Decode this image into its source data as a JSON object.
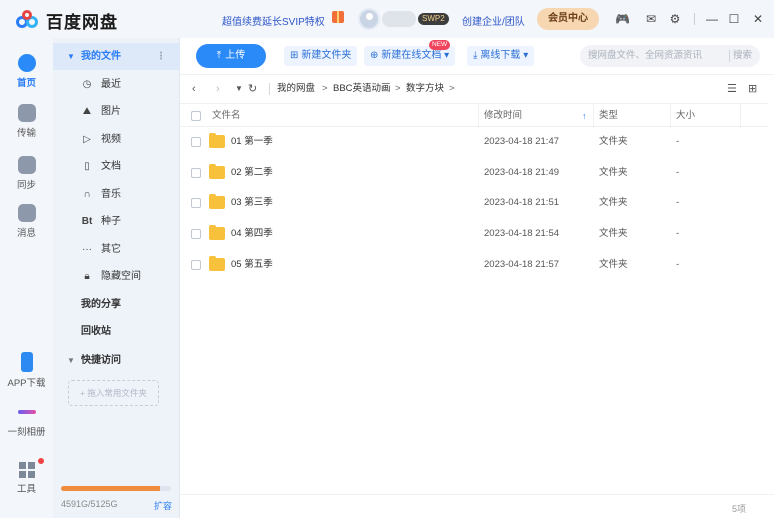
{
  "app": {
    "title": "百度网盘",
    "promo": "超值续费延长SVIP特权",
    "badge": "SWP2",
    "enterprise": "创建企业/团队",
    "member_center": "会员中心"
  },
  "window_icons": [
    "game-icon",
    "mail-icon",
    "settings-icon",
    "minimize-icon",
    "maximize-icon",
    "close-icon"
  ],
  "rail": {
    "home": "首页",
    "transfer": "传输",
    "sync": "同步",
    "messages": "消息",
    "app_download": "APP下载",
    "photo": "一刻相册",
    "tools": "工具"
  },
  "nav": {
    "my_files": "我的文件",
    "recent": "最近",
    "images": "图片",
    "videos": "视频",
    "docs": "文档",
    "music": "音乐",
    "torrents": "种子",
    "others": "其它",
    "hidden": "隐藏空间",
    "my_share": "我的分享",
    "recycle": "回收站",
    "quick_access": "快捷访问",
    "drag_hint": "+ 拖入常用文件夹",
    "storage_text": "4591G/5125G",
    "storage_used_fraction": 0.896,
    "expand": "扩容"
  },
  "toolbar": {
    "upload": "上传",
    "new_folder": "新建文件夹",
    "new_doc": "新建在线文档",
    "new_badge": "NEW",
    "offline_download": "离线下载",
    "search_placeholder": "搜网盘文件、全网资源资讯",
    "search_button": "搜索"
  },
  "breadcrumb": [
    "我的网盘",
    "BBC英语动画",
    "数字方块"
  ],
  "table": {
    "col_name": "文件名",
    "col_time": "修改时间",
    "col_type": "类型",
    "col_size": "大小",
    "rows": [
      {
        "name": "01 第一季",
        "time": "2023-04-18 21:47",
        "type": "文件夹",
        "size": "-"
      },
      {
        "name": "02 第二季",
        "time": "2023-04-18 21:49",
        "type": "文件夹",
        "size": "-"
      },
      {
        "name": "03 第三季",
        "time": "2023-04-18 21:51",
        "type": "文件夹",
        "size": "-"
      },
      {
        "name": "04 第四季",
        "time": "2023-04-18 21:54",
        "type": "文件夹",
        "size": "-"
      },
      {
        "name": "05 第五季",
        "time": "2023-04-18 21:57",
        "type": "文件夹",
        "size": "-"
      }
    ]
  },
  "footer": {
    "count": "5项"
  },
  "colors": {
    "accent": "#2a8af7",
    "folder": "#f7c13c",
    "storage": "#f08c3e"
  }
}
